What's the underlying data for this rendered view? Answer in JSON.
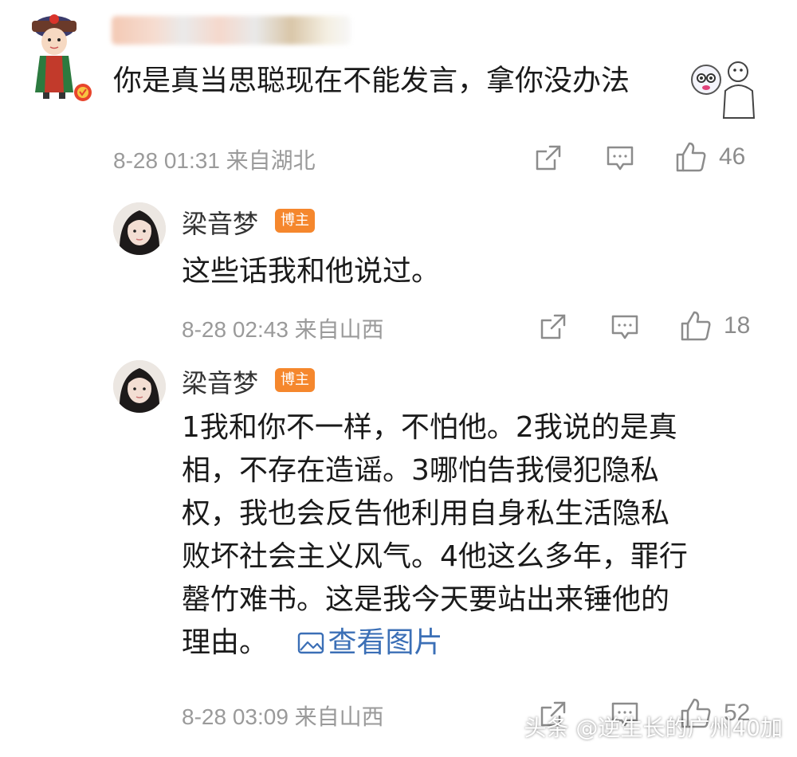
{
  "top_comment": {
    "text": "你是真当思聪现在不能发言，拿你没办法",
    "time": "8-28 01:31",
    "location": "来自湖北",
    "likes": "46",
    "icons": [
      "share-icon",
      "comment-icon",
      "like-icon"
    ]
  },
  "replies": [
    {
      "author": "梁音梦",
      "badge": "博主",
      "lines": [
        "这些话我和他说过。"
      ],
      "time": "8-28 02:43",
      "location": "来自山西",
      "likes": "18"
    },
    {
      "author": "梁音梦",
      "badge": "博主",
      "lines": [
        "1我和你不一样，不怕他。2我说的是真",
        "相，不存在造谣。3哪怕告我侵犯隐私",
        "权，我也会反告他利用自身私生活隐私",
        "败坏社会主义风气。4他这么多年，罪行",
        "罄竹难书。这是我今天要站出来锤他的",
        "理由。"
      ],
      "view_pic_label": "查看图片",
      "time": "8-28 03:09",
      "location": "来自山西",
      "likes": "52"
    }
  ],
  "watermark": "头条 @逆生长的广州40加",
  "colors": {
    "text": "#1a1a1a",
    "meta": "#9a9a9a",
    "badge": "#f5872d",
    "link": "#3b6fb6"
  }
}
